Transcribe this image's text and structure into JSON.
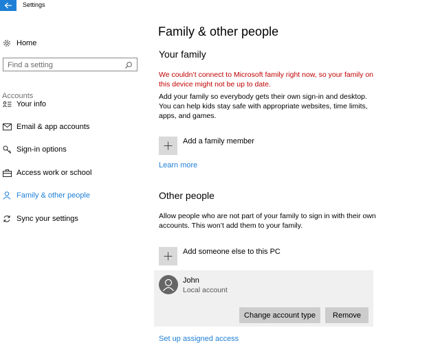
{
  "window": {
    "title": "Settings"
  },
  "sidebar": {
    "home_label": "Home",
    "search_placeholder": "Find a setting",
    "section_label": "Accounts",
    "items": [
      {
        "label": "Your info",
        "icon": "person-card-icon"
      },
      {
        "label": "Email & app accounts",
        "icon": "mail-icon"
      },
      {
        "label": "Sign-in options",
        "icon": "key-icon"
      },
      {
        "label": "Access work or school",
        "icon": "briefcase-icon"
      },
      {
        "label": "Family & other people",
        "icon": "person-icon",
        "active": true
      },
      {
        "label": "Sync your settings",
        "icon": "sync-icon"
      }
    ]
  },
  "main": {
    "title": "Family & other people",
    "your_family": {
      "heading": "Your family",
      "error": "We couldn’t connect to Microsoft family right now, so your family on this device might not be up to date.",
      "description": "Add your family so everybody gets their own sign-in and desktop. You can help kids stay safe with appropriate websites, time limits, apps, and games.",
      "add_label": "Add a family member",
      "learn_more": "Learn more"
    },
    "other_people": {
      "heading": "Other people",
      "description": "Allow people who are not part of your family to sign in with their own accounts. This won’t add them to your family.",
      "add_label": "Add someone else to this PC",
      "account": {
        "name": "John",
        "type": "Local account",
        "change_button": "Change account type",
        "remove_button": "Remove"
      },
      "assigned_access_link": "Set up assigned access"
    }
  },
  "colors": {
    "accent": "#1e7fd6",
    "error": "#c00000",
    "tile": "#d9d9d9",
    "card": "#f0f0f0",
    "button": "#cccccc"
  }
}
